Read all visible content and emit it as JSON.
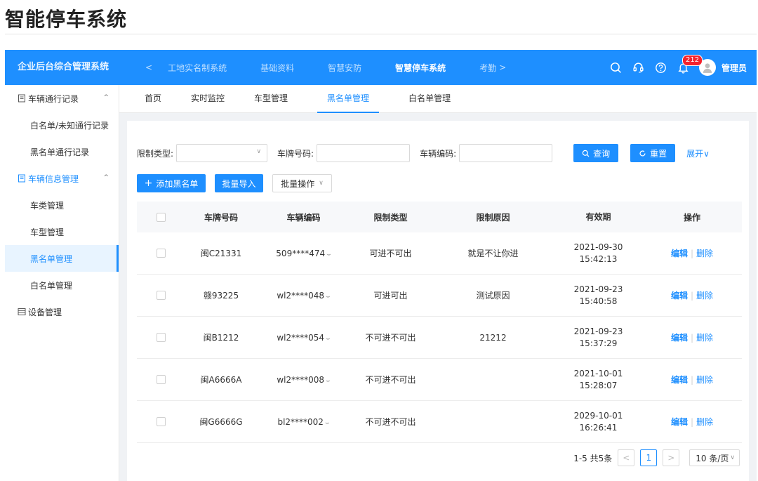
{
  "doc_title": "智能停车系统",
  "app": {
    "brand": "企业后台综合管理系统",
    "nav_prev": "<",
    "nav_items": [
      "工地实名制系统",
      "基础资料",
      "智慧安防",
      "智慧停车系统",
      "考勤"
    ],
    "nav_next": ">",
    "notification_count": "212",
    "username": "管理员"
  },
  "sidebar": {
    "groups": [
      {
        "label": "车辆通行记录",
        "caret": "^",
        "items": [
          "白名单/未知通行记录",
          "黑名单通行记录"
        ]
      },
      {
        "label": "车辆信息管理",
        "caret": "^",
        "items": [
          "车类管理",
          "车型管理",
          "黑名单管理",
          "白名单管理"
        ]
      },
      {
        "label": "设备管理"
      }
    ]
  },
  "tabs": [
    "首页",
    "实时监控",
    "车型管理",
    "黑名单管理",
    "白名单管理"
  ],
  "filters": {
    "limit_type_label": "限制类型:",
    "plate_label": "车牌号码:",
    "vehicle_code_label": "车辆编码:",
    "search_btn": "查询",
    "reset_btn": "重置",
    "expand": "展开"
  },
  "actions": {
    "add": "添加黑名单",
    "import": "批量导入",
    "batch": "批量操作"
  },
  "table": {
    "headers": [
      "车牌号码",
      "车辆编码",
      "限制类型",
      "限制原因",
      "有效期",
      "操作"
    ],
    "rows": [
      {
        "plate": "闽C21331",
        "code": "509****474",
        "type": "可进不可出",
        "reason": "就是不让你进",
        "date": "2021-09-30",
        "time": "15:42:13"
      },
      {
        "plate": "赣93225",
        "code": "wl2****048",
        "type": "可进可出",
        "reason": "测试原因",
        "date": "2021-09-23",
        "time": "15:40:58"
      },
      {
        "plate": "闽B1212",
        "code": "wl2****054",
        "type": "不可进不可出",
        "reason": "21212",
        "date": "2021-09-23",
        "time": "15:37:29"
      },
      {
        "plate": "闽A6666A",
        "code": "wl2****008",
        "type": "不可进不可出",
        "reason": "",
        "date": "2021-10-01",
        "time": "15:28:07"
      },
      {
        "plate": "闽G6666G",
        "code": "bl2****002",
        "type": "不可进不可出",
        "reason": "",
        "date": "2029-10-01",
        "time": "16:26:41"
      }
    ],
    "edit": "编辑",
    "delete": "删除"
  },
  "pagination": {
    "summary": "1-5 共5条",
    "current_page": "1",
    "page_size": "10 条/页"
  },
  "colors": {
    "primary": "#1e8fff",
    "badge": "#f5222d"
  }
}
